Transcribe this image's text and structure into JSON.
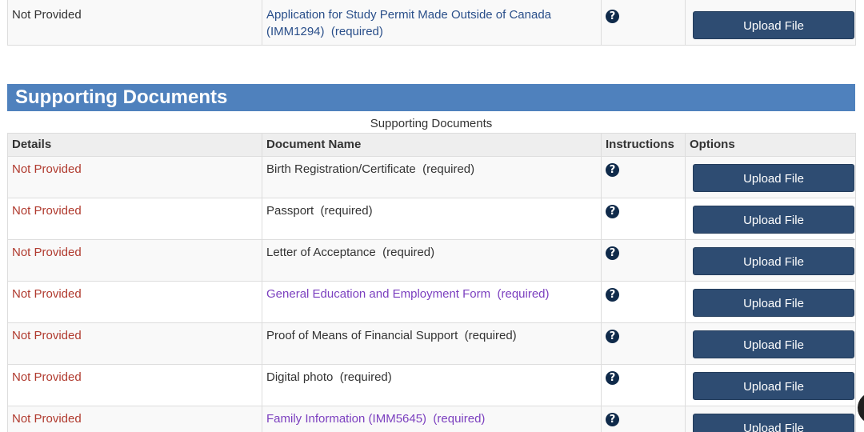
{
  "top_row": {
    "details": "Not Provided",
    "document_name": "Application for Study Permit Made Outside of Canada (IMM1294)",
    "required": "(required)",
    "help_icon": "question-circle-icon",
    "upload_label": "Upload File"
  },
  "section": {
    "title": "Supporting Documents",
    "caption": "Supporting Documents",
    "header_color": "#4f81bd",
    "columns": {
      "details": "Details",
      "document_name": "Document Name",
      "instructions": "Instructions",
      "options": "Options"
    },
    "rows": [
      {
        "details": "Not Provided",
        "document_name": "Birth Registration/Certificate",
        "required": "(required)",
        "upload_label": "Upload File"
      },
      {
        "details": "Not Provided",
        "document_name": "Passport",
        "required": "(required)",
        "upload_label": "Upload File"
      },
      {
        "details": "Not Provided",
        "document_name": "Letter of Acceptance",
        "required": "(required)",
        "upload_label": "Upload File"
      },
      {
        "details": "Not Provided",
        "document_name": "General Education and Employment Form",
        "required": "(required)",
        "upload_label": "Upload File"
      },
      {
        "details": "Not Provided",
        "document_name": "Proof of Means of Financial Support",
        "required": "(required)",
        "upload_label": "Upload File"
      },
      {
        "details": "Not Provided",
        "document_name": "Digital photo",
        "required": "(required)",
        "upload_label": "Upload File"
      },
      {
        "details": "Not Provided",
        "document_name": "Family Information (IMM5645)",
        "required": "(required)",
        "upload_label": "Upload File"
      }
    ]
  },
  "colors": {
    "not_provided": "#b03a2e",
    "link_visited": "#7b3fbf",
    "button_bg": "#2e4c72"
  }
}
